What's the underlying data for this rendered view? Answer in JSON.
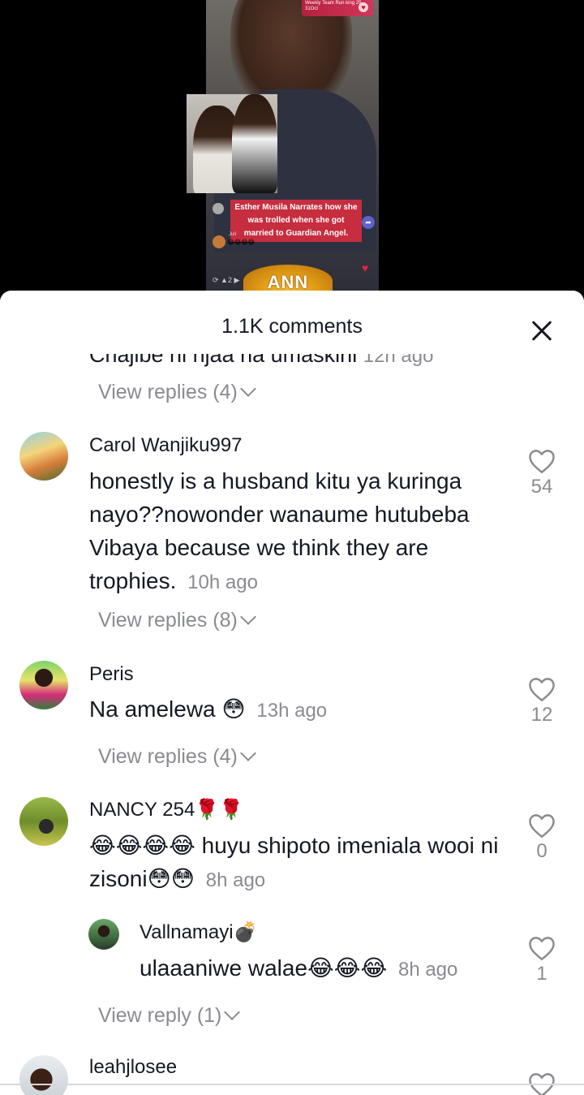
{
  "video": {
    "badge_text": "Weekly Team Run king 25-31Oct",
    "caption": "Esther Musila Narrates how she was trolled when she got married to Guardian Angel.",
    "logo_text": "ANN",
    "small_label": "Juli"
  },
  "sheet": {
    "title": "1.1K comments",
    "close_icon": "close-icon"
  },
  "cut_comment": {
    "text": "Chajibe ni njaa na umaskini",
    "time": "12h ago",
    "replies_label": "View replies (4)"
  },
  "comments": [
    {
      "username": "Carol Wanjiku997",
      "text": "honestly is a husband kitu ya kuringa nayo??nowonder wanaume hutubeba Vibaya because we think they are trophies.",
      "time": "10h ago",
      "likes": "54",
      "replies_label": "View replies (8)"
    },
    {
      "username": "Peris",
      "text": "Na amelewa 😳",
      "time": "13h ago",
      "likes": "12",
      "replies_label": "View replies (4)"
    },
    {
      "username": "NANCY 254🌹🌹",
      "text": "😂😂😂😂 huyu shipoto imeniala wooi ni zisoni😳😳",
      "time": "8h ago",
      "likes": "0"
    },
    {
      "username": "leahjlosee"
    }
  ],
  "reply": {
    "username": "Vallnamayi💣",
    "text": "ulaaaniwe walae😂😂😂",
    "time": "8h ago",
    "likes": "1",
    "replies_label": "View reply (1)"
  },
  "colors": {
    "text_primary": "#161823",
    "text_secondary": "#8a8b91",
    "caption_bg": "#c62d3f"
  }
}
